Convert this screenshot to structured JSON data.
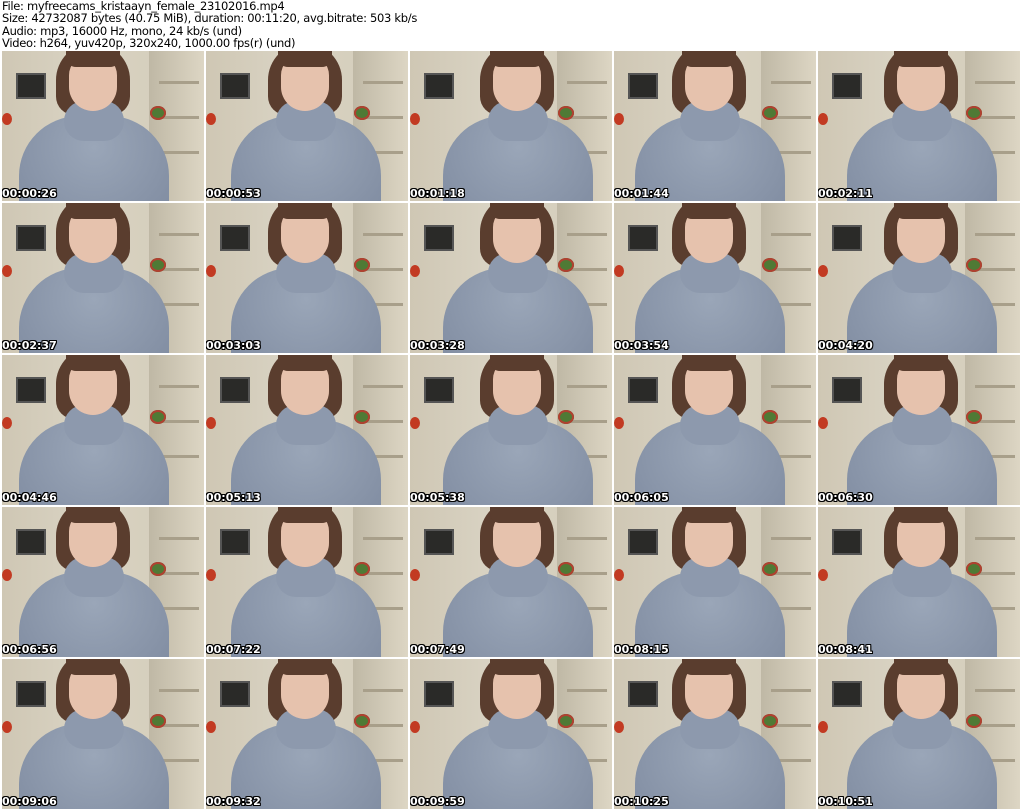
{
  "info": {
    "file": "File: myfreecams_kristaayn_female_23102016.mp4",
    "size": "Size: 42732087 bytes (40.75 MiB), duration: 00:11:20, avg.bitrate: 503 kb/s",
    "audio": "Audio: mp3, 16000 Hz, mono, 24 kb/s (und)",
    "video": "Video: h264, yuv420p, 320x240, 1000.00 fps(r) (und)"
  },
  "thumbnails": [
    "00:00:26",
    "00:00:53",
    "00:01:18",
    "00:01:44",
    "00:02:11",
    "00:02:37",
    "00:03:03",
    "00:03:28",
    "00:03:54",
    "00:04:20",
    "00:04:46",
    "00:05:13",
    "00:05:38",
    "00:06:05",
    "00:06:30",
    "00:06:56",
    "00:07:22",
    "00:07:49",
    "00:08:15",
    "00:08:41",
    "00:09:06",
    "00:09:32",
    "00:09:59",
    "00:10:25",
    "00:10:51"
  ]
}
